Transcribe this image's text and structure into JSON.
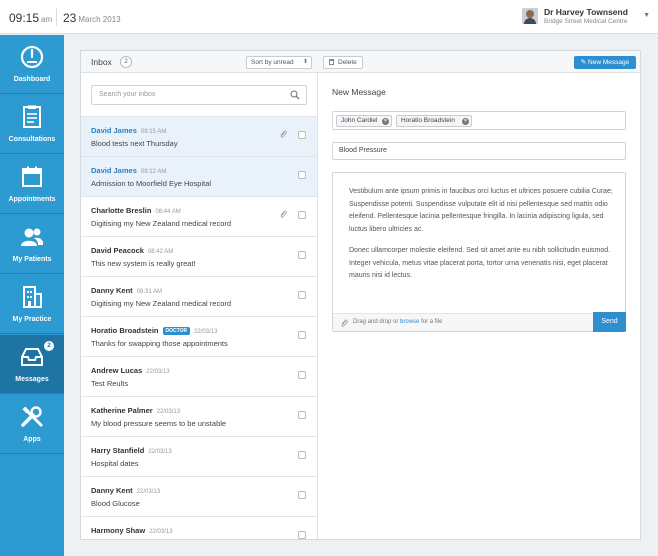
{
  "topbar": {
    "time": "09:15",
    "ampm": "am",
    "day": "23",
    "month_year": "March 2013",
    "user_name": "Dr Harvey Townsend",
    "user_org": "Bridge Street Medical Centre"
  },
  "sidebar": {
    "items": [
      {
        "label": "Dashboard",
        "icon": "dashboard-gauge-icon"
      },
      {
        "label": "Consultations",
        "icon": "clipboard-icon"
      },
      {
        "label": "Appointments",
        "icon": "calendar-icon"
      },
      {
        "label": "My Patients",
        "icon": "users-icon"
      },
      {
        "label": "My Practice",
        "icon": "building-icon"
      },
      {
        "label": "Messages",
        "icon": "inbox-tray-icon",
        "badge": "2"
      },
      {
        "label": "Apps",
        "icon": "tools-icon"
      }
    ],
    "active": "Messages"
  },
  "inbox": {
    "title": "Inbox",
    "count": "2",
    "sort_label": "Sort by unread",
    "delete_label": "Delete",
    "new_message_label": "New Message",
    "search_placeholder": "Search your inbox",
    "messages": [
      {
        "sender": "David James",
        "time": "09:15 AM",
        "tag": "",
        "subject": "Blood tests next Thursday",
        "attachment": true,
        "selected": true
      },
      {
        "sender": "David James",
        "time": "09:12 AM",
        "tag": "",
        "subject": "Admission to Moorfield Eye Hospital",
        "attachment": false,
        "selected": true
      },
      {
        "sender": "Charlotte Breslin",
        "time": "08:44 AM",
        "tag": "",
        "subject": "Digitising my New Zealand medical record",
        "attachment": true,
        "selected": false
      },
      {
        "sender": "David Peacock",
        "time": "08:42 AM",
        "tag": "",
        "subject": "This new system is really great!",
        "attachment": false,
        "selected": false
      },
      {
        "sender": "Danny Kent",
        "time": "08:31 AM",
        "tag": "",
        "subject": "Digitising my New Zealand medical record",
        "attachment": false,
        "selected": false
      },
      {
        "sender": "Horatio Broadstein",
        "time": "22/03/13",
        "tag": "DOCTOR",
        "subject": "Thanks for swapping those appointments",
        "attachment": false,
        "selected": false
      },
      {
        "sender": "Andrew Lucas",
        "time": "22/03/13",
        "tag": "",
        "subject": "Test Reults",
        "attachment": false,
        "selected": false
      },
      {
        "sender": "Katherine Palmer",
        "time": "22/03/13",
        "tag": "",
        "subject": "My blood pressure seems to be unstable",
        "attachment": false,
        "selected": false
      },
      {
        "sender": "Harry Stanfield",
        "time": "22/03/13",
        "tag": "",
        "subject": "Hospital dates",
        "attachment": false,
        "selected": false
      },
      {
        "sender": "Danny Kent",
        "time": "22/03/13",
        "tag": "",
        "subject": "Blood Glucose",
        "attachment": false,
        "selected": false
      },
      {
        "sender": "Harmony Shaw",
        "time": "22/03/13",
        "tag": "",
        "subject": "",
        "attachment": false,
        "selected": false
      }
    ]
  },
  "compose": {
    "title": "New Message",
    "recipients": [
      "John Cardiel",
      "Horatio Broadstein"
    ],
    "subject": "Blood Pressure",
    "body_p1": "Vestibulum ante ipsum primis in faucibus orci luctus et ultrices posuere cubilia Curae; Suspendisse potenti. Suspendisse vulputate elit id nisi pellentesque sed mattis odio eleifend. Pellentesque lacinia pellentesque fringilla. In lacinia adipiscing ligula, sed luctus libero ultricies ac.",
    "body_p2": "Donec ullamcorper molestie eleifend. Sed sit amet ante eu nibh sollicitudin euismod. Integer vehicula, metus vitae placerat porta, tortor urna venenatis nisi, eget placerat mauris nisi id lectus.",
    "attach_prefix": "Drag and drop or",
    "attach_link": "browse",
    "attach_suffix": "for a file",
    "send_label": "Send"
  },
  "colors": {
    "sidebar": "#2d9ad2",
    "sidebar_active": "#1e74a3",
    "accent": "#2e8fd0",
    "selected_row": "#e9f2fa"
  }
}
